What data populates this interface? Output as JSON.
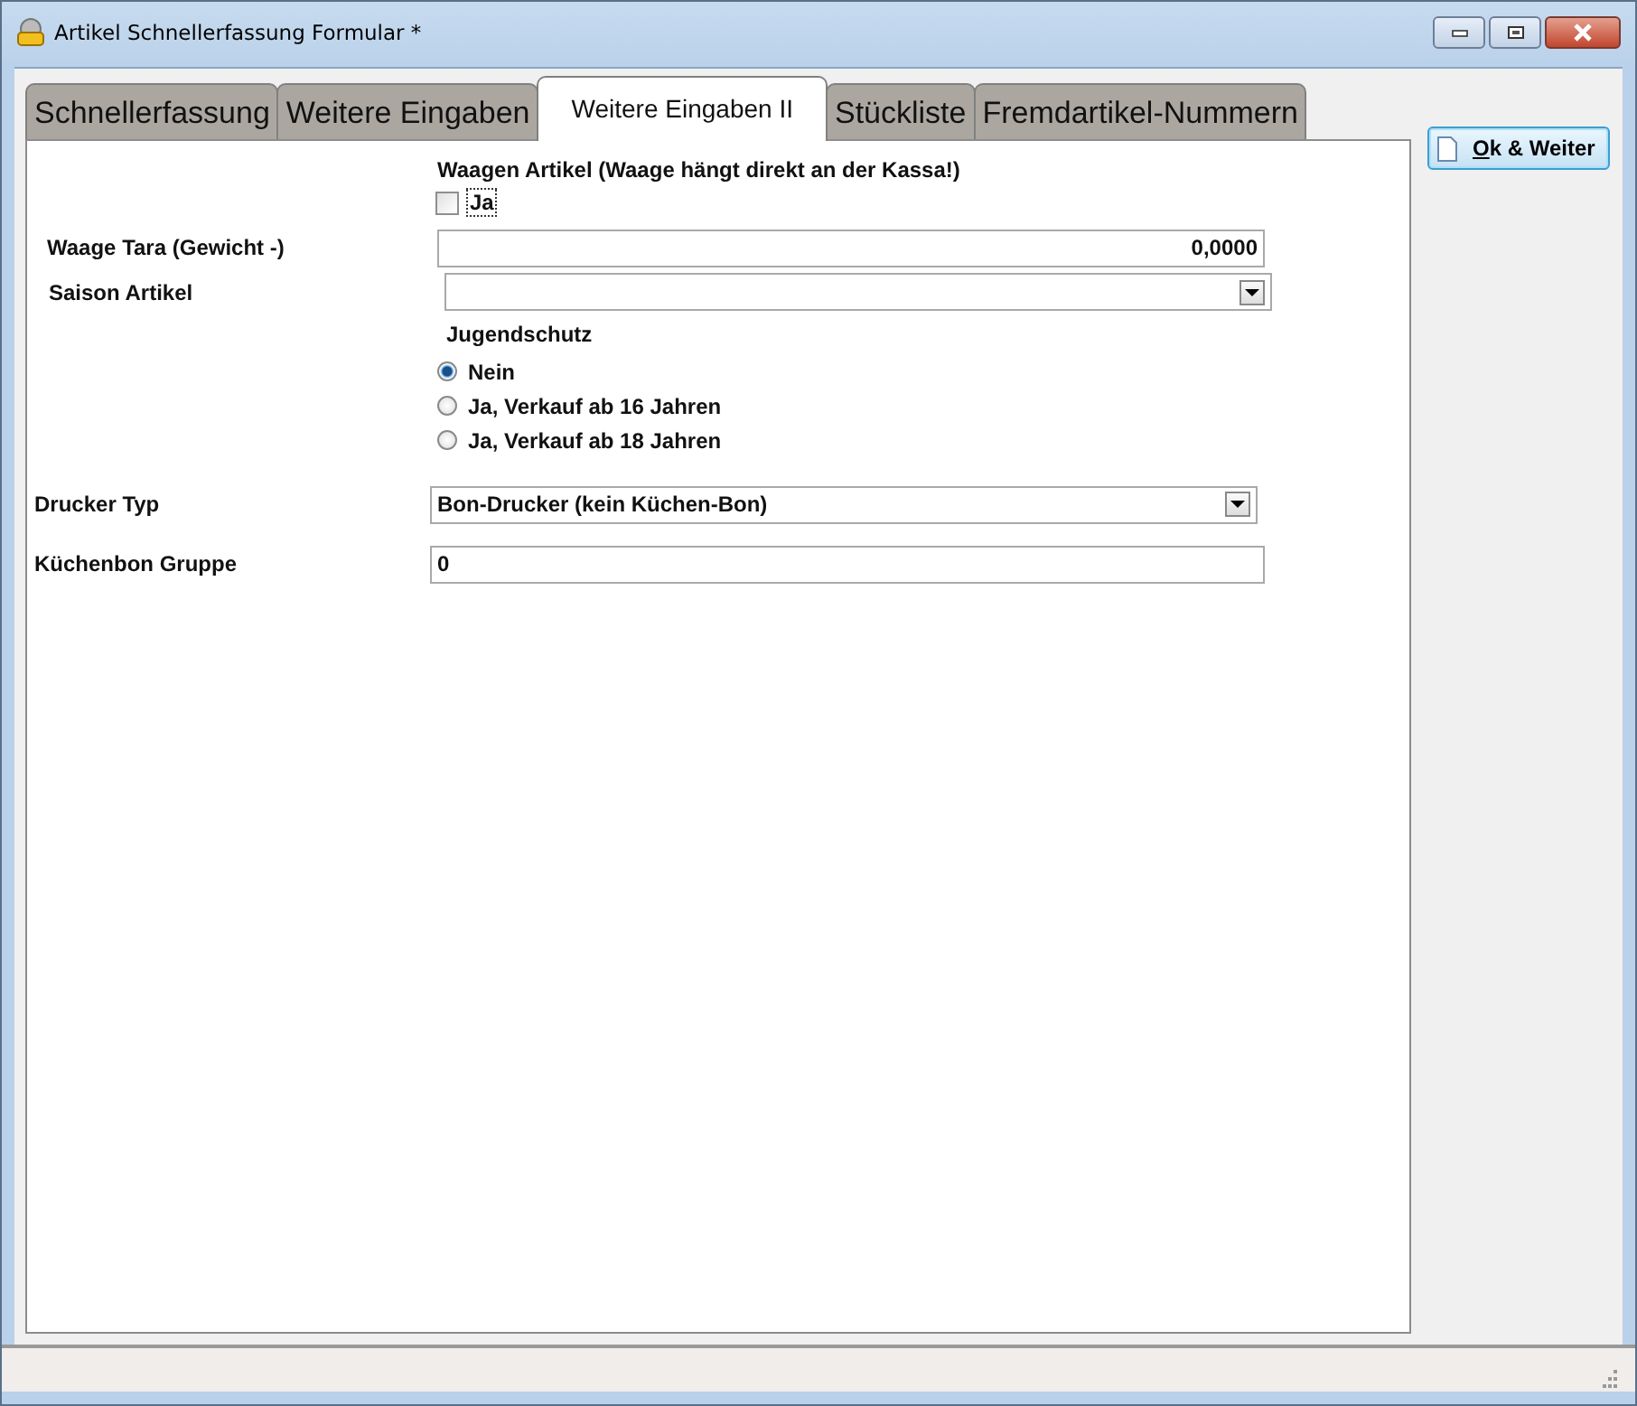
{
  "window": {
    "title": "Artikel Schnellerfassung Formular *"
  },
  "tabs": [
    {
      "label": "Schnellerfassung",
      "selected": false
    },
    {
      "label": "Weitere Eingaben",
      "selected": false
    },
    {
      "label": "Weitere Eingaben II",
      "selected": true
    },
    {
      "label": "Stückliste",
      "selected": false
    },
    {
      "label": "Fremdartikel-Nummern",
      "selected": false
    }
  ],
  "form": {
    "scale_heading": "Waagen Artikel (Waage hängt direkt an der Kassa!)",
    "scale_checkbox": {
      "label": "Ja",
      "checked": false
    },
    "tare": {
      "label": "Waage Tara (Gewicht -)",
      "value": "0,0000"
    },
    "season": {
      "label": "Saison Artikel"
    },
    "youth": {
      "label": "Jugendschutz",
      "options": [
        {
          "label": "Nein",
          "selected": true
        },
        {
          "label": "Ja, Verkauf ab 16 Jahren",
          "selected": false
        },
        {
          "label": "Ja, Verkauf ab 18 Jahren",
          "selected": false
        }
      ]
    },
    "printer": {
      "label": "Drucker Typ",
      "value": "Bon-Drucker (kein Küchen-Bon)"
    },
    "kitchen": {
      "label": "Küchenbon Gruppe",
      "value": "0"
    }
  },
  "buttons": [
    {
      "label": "Ok & Weiter"
    }
  ]
}
